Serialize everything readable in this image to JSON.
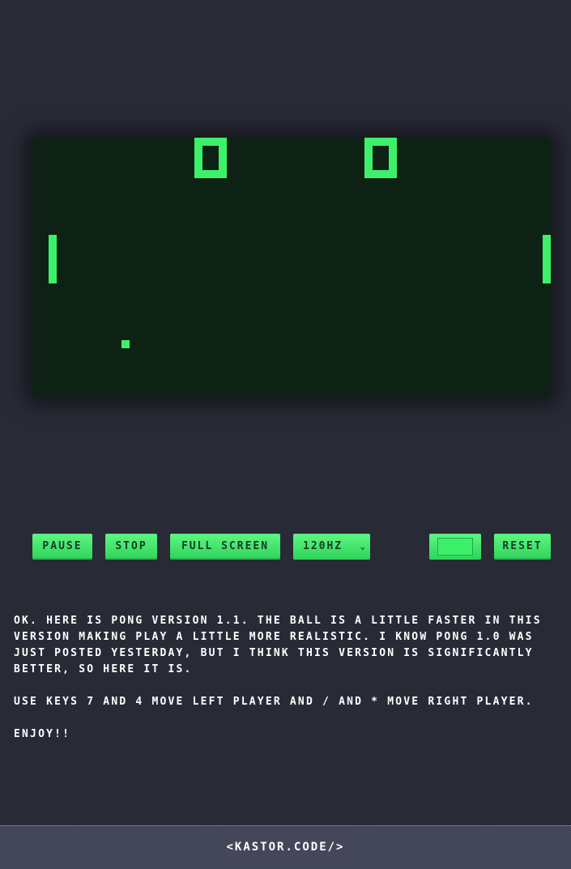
{
  "game": {
    "score_left": "0",
    "score_right": "0",
    "colors": {
      "background": "#0d2214",
      "foreground": "#3cf06a"
    }
  },
  "controls": {
    "pause_label": "Pause",
    "stop_label": "Stop",
    "fullscreen_label": "Full Screen",
    "refresh_rate_selected": "120Hz",
    "color_value": "#3cf06a",
    "reset_label": "Reset"
  },
  "description": {
    "paragraph_1": "Ok. Here is Pong version 1.1. The ball is a little faster in this version making play a little more realistic. I know Pong 1.0 was just posted yesterday, but I think this version is significantly better, so here it is.",
    "paragraph_2": "Use keys 7 and 4 move left player and / and * move right player.",
    "paragraph_3": "Enjoy!!"
  },
  "footer": {
    "link_text": "<kastor.code/>"
  },
  "page": {
    "background": "#282a36",
    "footer_background": "#44475a",
    "footer_border": "#ff79c6"
  }
}
